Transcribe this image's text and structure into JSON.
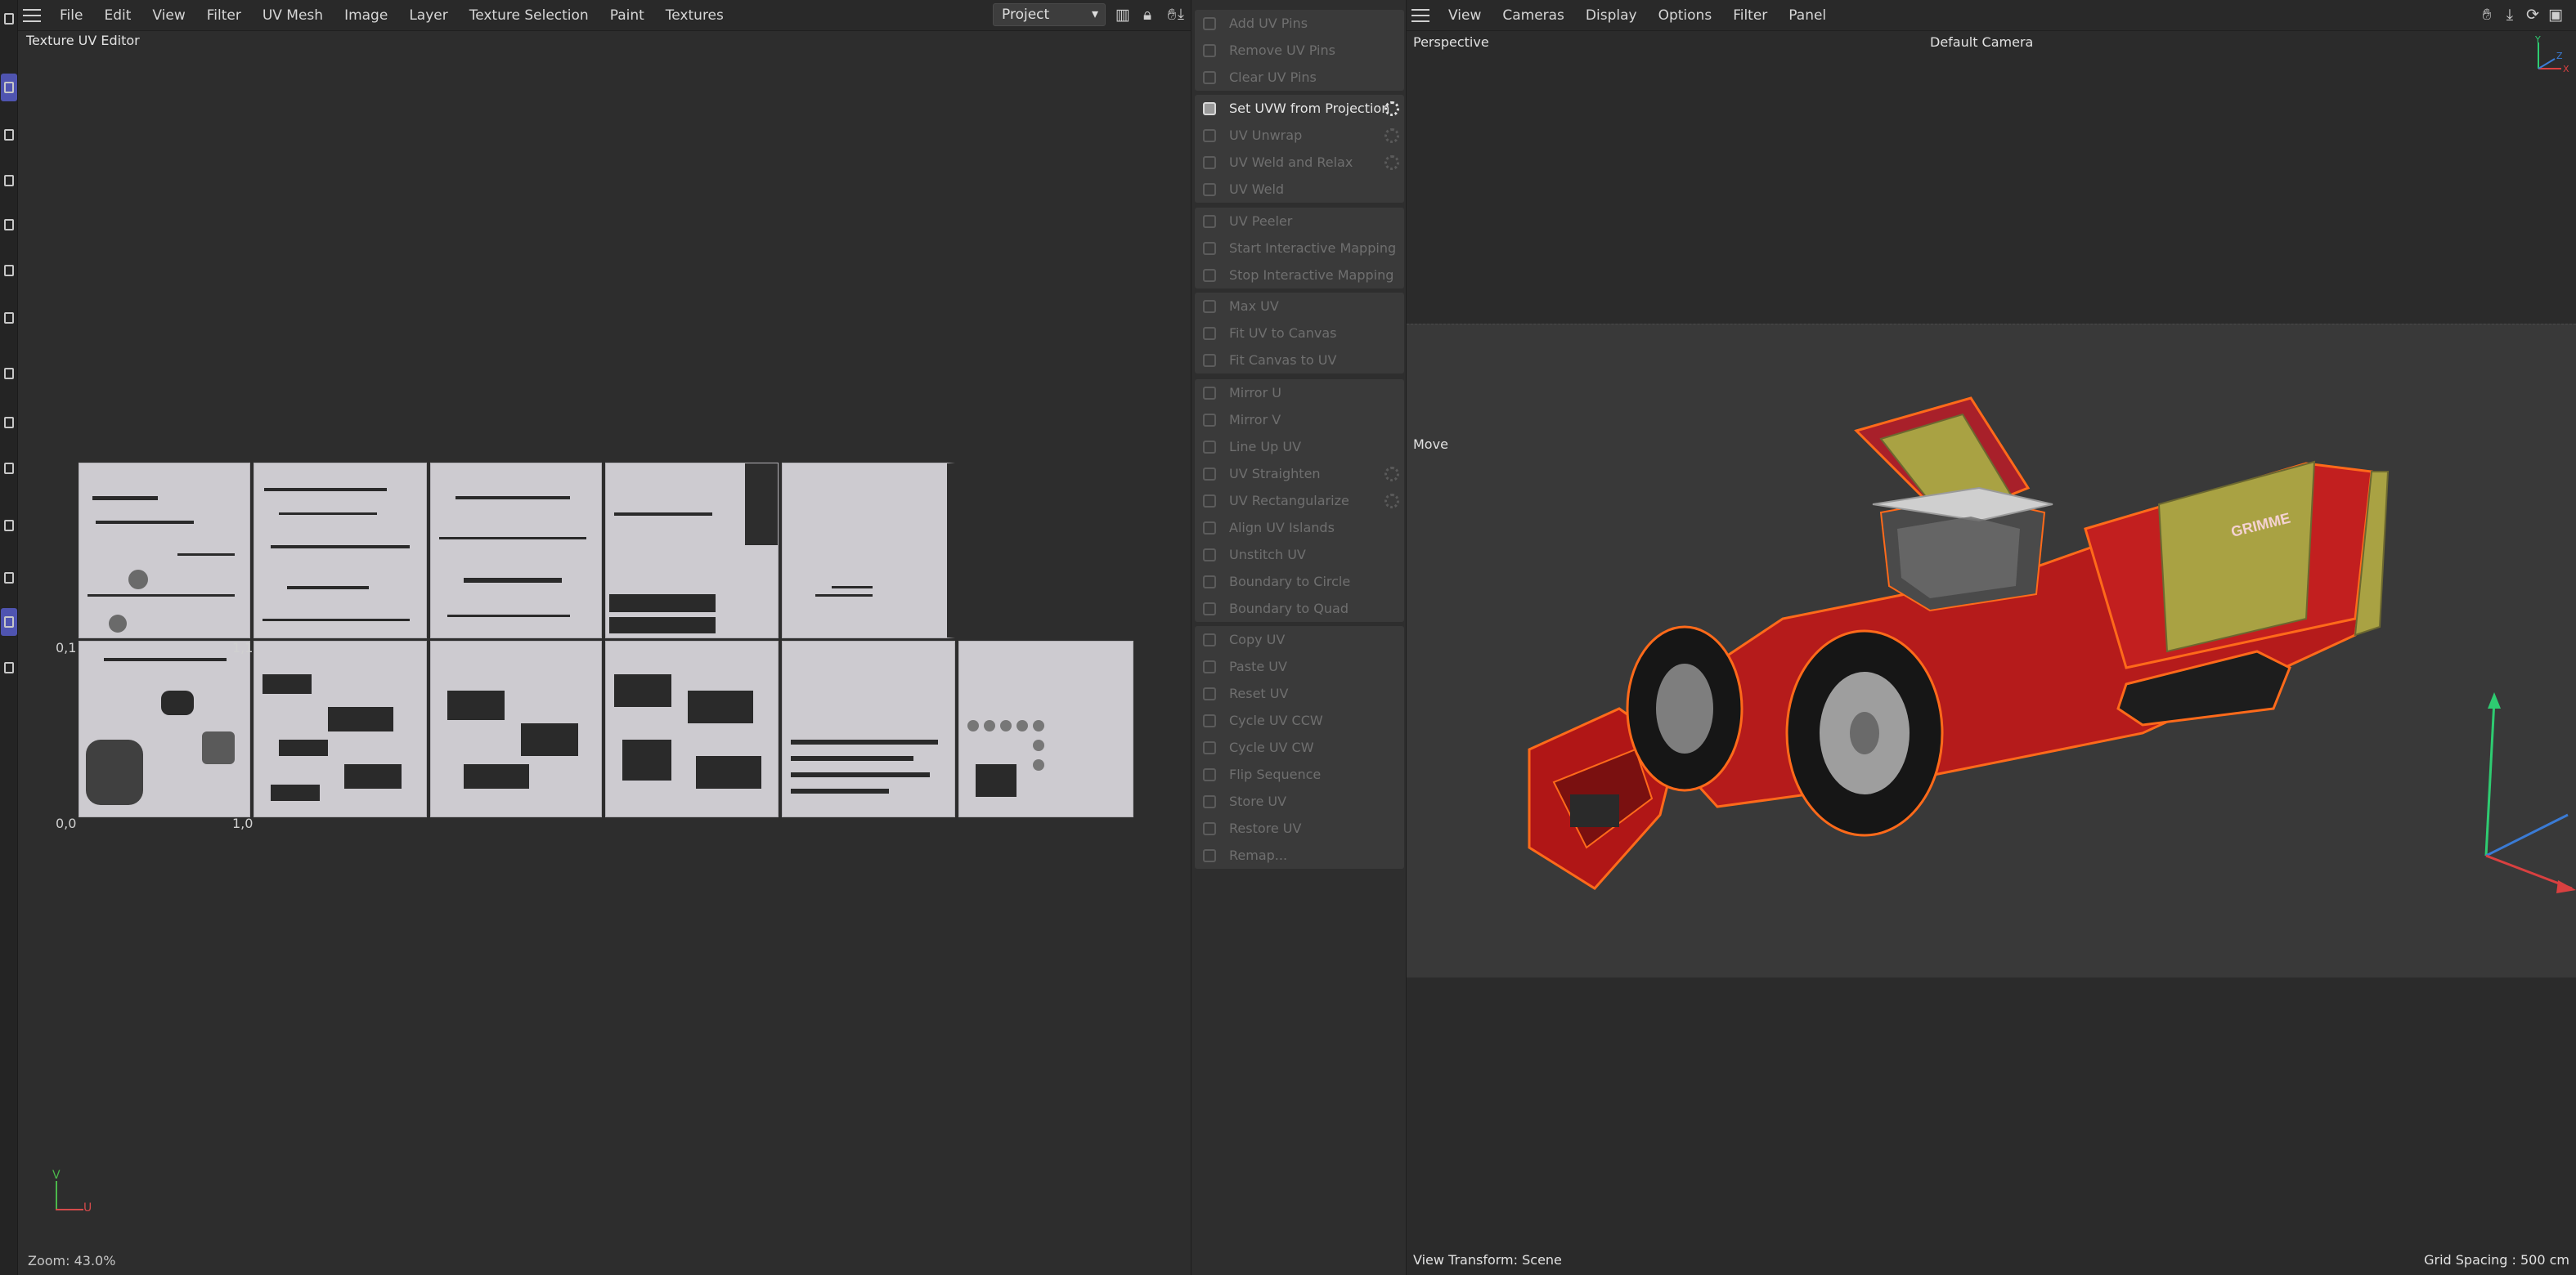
{
  "uv_editor": {
    "menu": [
      "File",
      "Edit",
      "View",
      "Filter",
      "UV Mesh",
      "Image",
      "Layer",
      "Texture Selection",
      "Paint",
      "Textures"
    ],
    "mode_select": "Project",
    "title": "Texture UV Editor",
    "zoom": "Zoom: 43.0%",
    "coords": {
      "top_left": "0,1",
      "top_right": "1,1",
      "origin": "0,0",
      "bottom_right": "1,0"
    },
    "axis": {
      "v": "V",
      "u": "U"
    }
  },
  "uv_commands": {
    "groups": [
      [
        "Add UV Pins",
        "Remove UV Pins",
        "Clear UV Pins"
      ],
      [
        "Set UVW from Projection",
        "UV Unwrap",
        "UV Weld and Relax",
        "UV Weld"
      ],
      [
        "UV Peeler",
        "Start Interactive Mapping",
        "Stop Interactive Mapping"
      ],
      [
        "Max UV",
        "Fit UV to Canvas",
        "Fit Canvas to UV"
      ],
      [
        "Mirror U",
        "Mirror V",
        "Line Up UV",
        "UV Straighten",
        "UV Rectangularize",
        "Align UV Islands",
        "Unstitch UV",
        "Boundary to Circle",
        "Boundary to Quad"
      ],
      [
        "Copy UV",
        "Paste UV",
        "Reset UV",
        "Cycle UV CCW",
        "Cycle UV CW",
        "Flip Sequence",
        "Store UV",
        "Restore UV",
        "Remap..."
      ]
    ],
    "enabled": [
      "Set UVW from Projection"
    ],
    "with_settings": [
      "Set UVW from Projection",
      "UV Unwrap",
      "UV Weld and Relax",
      "UV Straighten",
      "UV Rectangularize"
    ]
  },
  "viewport": {
    "menu": [
      "View",
      "Cameras",
      "Display",
      "Options",
      "Filter",
      "Panel"
    ],
    "projection": "Perspective",
    "camera": "Default Camera",
    "tool": "Move",
    "view_transform": "View Transform: Scene",
    "grid_spacing": "Grid Spacing : 500 cm",
    "model_brand": "GRIMME",
    "axis_labels": [
      "Y",
      "Z",
      "X"
    ]
  }
}
